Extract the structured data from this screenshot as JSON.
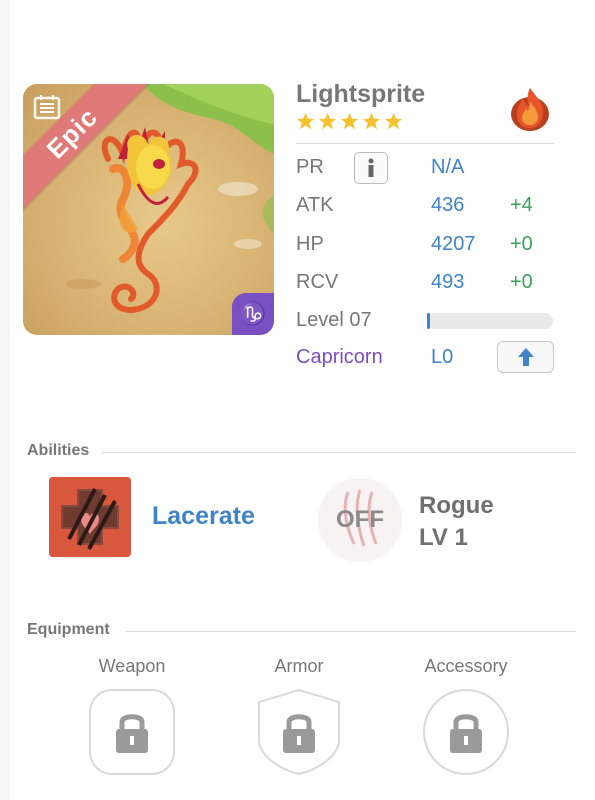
{
  "monster": {
    "name": "Lightsprite",
    "rarity": "Epic",
    "stars": 5,
    "element_icon": "fire-element-icon",
    "zodiac_badge_glyph": "♑"
  },
  "stats": {
    "pr": {
      "label": "PR",
      "value": "N/A"
    },
    "atk": {
      "label": "ATK",
      "value": "436",
      "bonus": "+4"
    },
    "hp": {
      "label": "HP",
      "value": "4207",
      "bonus": "+0"
    },
    "rcv": {
      "label": "RCV",
      "value": "493",
      "bonus": "+0"
    },
    "level": {
      "label": "Level 07",
      "progress": 0.02
    },
    "zodiac": {
      "label": "Capricorn",
      "value": "L0"
    }
  },
  "abilities": {
    "title": "Abilities",
    "active": {
      "name": "Lacerate"
    },
    "passive": {
      "state": "OFF",
      "name": "Rogue",
      "level": "LV 1"
    }
  },
  "equipment": {
    "title": "Equipment",
    "slots": [
      {
        "label": "Weapon",
        "locked": true
      },
      {
        "label": "Armor",
        "locked": true
      },
      {
        "label": "Accessory",
        "locked": true
      }
    ]
  },
  "colors": {
    "accent_blue": "#3f84c8",
    "bonus_green": "#3aa35a",
    "zodiac_purple": "#7a4fc1",
    "epic_ribbon": "#e07a78",
    "star_gold": "#f4c430"
  }
}
